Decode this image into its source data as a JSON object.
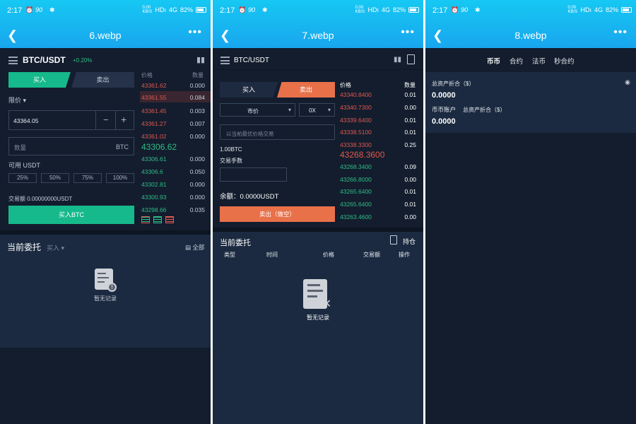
{
  "status": {
    "time": "2:17",
    "net_speed": "0.00 KB/S",
    "hd": "HDı",
    "signal": "4G",
    "battery": "82%",
    "speed_tag": "90"
  },
  "screens": [
    {
      "title": "6.webp",
      "pair": "BTC/USDT",
      "change": "+0.20%",
      "tab_buy": "买入",
      "tab_sell": "卖出",
      "order_type": "限价",
      "price_value": "43364.05",
      "minus": "−",
      "plus": "+",
      "qty_placeholder": "数量",
      "qty_unit": "BTC",
      "available": "可用 USDT",
      "pcts": [
        "25%",
        "50%",
        "75%",
        "100%"
      ],
      "amount": "交易额 0.00000000USDT",
      "buy_btn": "买入BTC",
      "ob_head_price": "价格",
      "ob_head_qty": "数量",
      "asks": [
        {
          "p": "43361.62",
          "q": "0.000"
        },
        {
          "p": "43361.55",
          "q": "0.084"
        },
        {
          "p": "43361.45",
          "q": "0.003"
        },
        {
          "p": "43361.27",
          "q": "0.007"
        },
        {
          "p": "43361.02",
          "q": "0.000"
        }
      ],
      "last": "43306.62",
      "bids": [
        {
          "p": "43306.61",
          "q": "0.000"
        },
        {
          "p": "43306.6",
          "q": "0.050"
        },
        {
          "p": "43302.81",
          "q": "0.000"
        },
        {
          "p": "43300.93",
          "q": "0.000"
        },
        {
          "p": "43298.66",
          "q": "0.035"
        }
      ],
      "orders_title": "当前委托",
      "orders_filter": "买入",
      "orders_all": "全部",
      "empty": "暂无记录"
    },
    {
      "title": "7.webp",
      "pair": "BTC/USDT",
      "tab_buy": "买入",
      "tab_sell": "卖出",
      "market": "市价",
      "leverage": "0X",
      "price_placeholder": "以当前最优价格交易",
      "qty": "1.00BTC",
      "fee_label": "交易手数",
      "balance": "余额：0.0000USDT",
      "sell_btn": "卖出（做空）",
      "ob_head_price": "价格",
      "ob_head_qty": "数量",
      "asks": [
        {
          "p": "43340.8400",
          "q": "0.01"
        },
        {
          "p": "43340.7300",
          "q": "0.00"
        },
        {
          "p": "43339.6400",
          "q": "0.01"
        },
        {
          "p": "43338.5100",
          "q": "0.01"
        },
        {
          "p": "43338.3300",
          "q": "0.25"
        }
      ],
      "last": "43268.3600",
      "bids": [
        {
          "p": "43268.3400",
          "q": "0.09"
        },
        {
          "p": "43266.8000",
          "q": "0.00"
        },
        {
          "p": "43265.6400",
          "q": "0.01"
        },
        {
          "p": "43265.6400",
          "q": "0.01"
        },
        {
          "p": "43263.4600",
          "q": "0.00"
        }
      ],
      "orders_title": "当前委托",
      "position": "持仓",
      "cols": [
        "类型",
        "时间",
        "价格",
        "交易额",
        "操作"
      ],
      "empty": "暂无记录"
    },
    {
      "title": "8.webp",
      "tabs": [
        "币币",
        "合约",
        "法币",
        "秒合约"
      ],
      "total_label": "总资产折合（$）",
      "total_value": "0.0000",
      "account_label": "币币账户",
      "account_sub": "总资产折合（$）",
      "account_value": "0.0000"
    }
  ],
  "colors": {
    "green": "#2ebd85",
    "red": "#e0584d",
    "orange": "#e8714a",
    "bg": "#131d2e"
  }
}
